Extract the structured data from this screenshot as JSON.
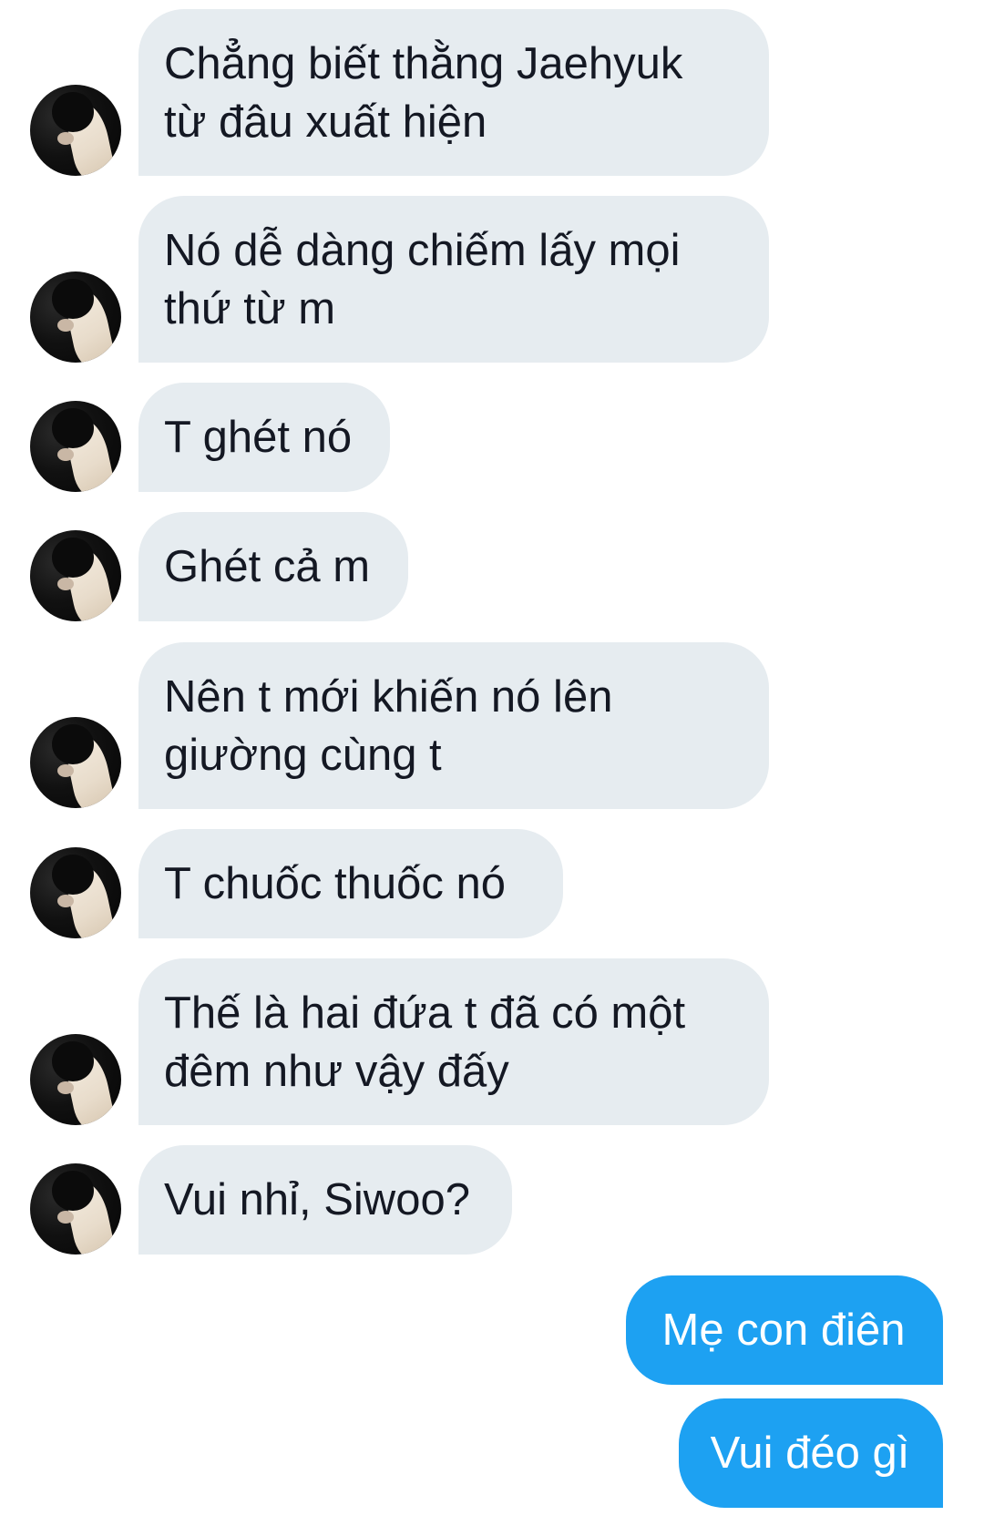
{
  "conversation": {
    "incoming": [
      {
        "text": "Chẳng biết thằng Jaehyuk\ntừ đâu xuất hiện"
      },
      {
        "text": "Nó dễ dàng chiếm lấy mọi\nthứ từ m"
      },
      {
        "text": "T ghét nó"
      },
      {
        "text": "Ghét cả m"
      },
      {
        "text": "Nên t mới khiến nó lên\ngiường cùng t"
      },
      {
        "text": "T chuốc thuốc nó"
      },
      {
        "text": "Thế là hai đứa t đã có một\nđêm như vậy đấy"
      },
      {
        "text": "Vui nhỉ, Siwoo?"
      }
    ],
    "outgoing": [
      {
        "text": "Mẹ con điên"
      },
      {
        "text": "Vui đéo gì"
      }
    ]
  },
  "colors": {
    "incoming_bubble": "#e6ecf0",
    "incoming_text": "#141823",
    "outgoing_bubble": "#1da1f2",
    "outgoing_text": "#ffffff",
    "background": "#ffffff"
  }
}
